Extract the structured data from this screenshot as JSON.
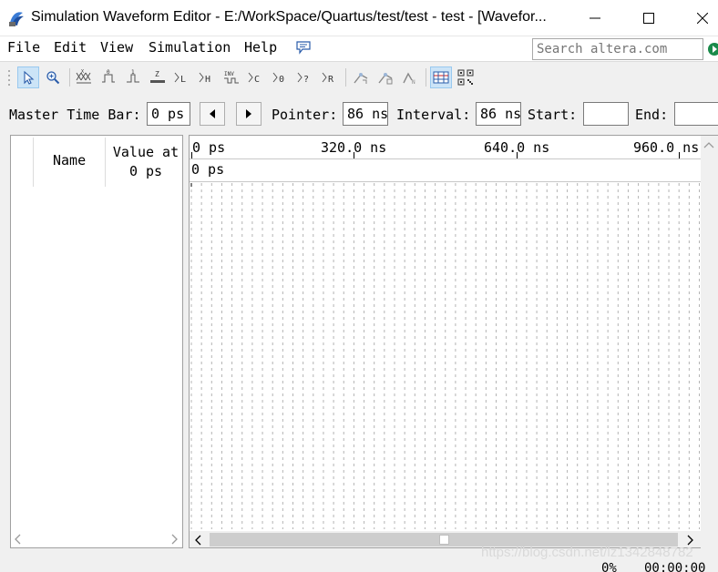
{
  "window": {
    "title": "Simulation Waveform Editor - E:/WorkSpace/Quartus/test/test - test - [Wavefor...",
    "minimize_icon": "minimize-icon",
    "maximize_icon": "maximize-icon",
    "close_icon": "close-icon"
  },
  "menu": {
    "items": [
      "File",
      "Edit",
      "View",
      "Simulation",
      "Help"
    ]
  },
  "search": {
    "placeholder": "Search altera.com"
  },
  "toolbar": {
    "buttons": [
      {
        "name": "selection-tool",
        "label": ""
      },
      {
        "name": "zoom-tool",
        "label": ""
      },
      {
        "name": "forcing-unknown",
        "label": "X"
      },
      {
        "name": "forcing-low",
        "label": "0"
      },
      {
        "name": "forcing-high",
        "label": "1"
      },
      {
        "name": "high-impedance",
        "label": "Z"
      },
      {
        "name": "weak-low",
        "label": "L"
      },
      {
        "name": "weak-high",
        "label": "H"
      },
      {
        "name": "invert",
        "label": "INV"
      },
      {
        "name": "count-value",
        "label": "C"
      },
      {
        "name": "forcing-value",
        "label": "0"
      },
      {
        "name": "random-value",
        "label": "?"
      },
      {
        "name": "arbitrary-value",
        "label": "R"
      }
    ]
  },
  "timebar": {
    "master_label": "Master Time Bar:",
    "master_value": "0 ps",
    "pointer_label": "Pointer:",
    "pointer_value": "86 ns",
    "interval_label": "Interval:",
    "interval_value": "86 ns",
    "start_label": "Start:",
    "start_value": "",
    "end_label": "End:",
    "end_value": ""
  },
  "signal_table": {
    "name_header": "Name",
    "value_header_line1": "Value at",
    "value_header_line2": "0 ps"
  },
  "ruler": {
    "labels": [
      "0 ps",
      "320.0 ns",
      "640.0 ns",
      "960.0 ns"
    ],
    "cursor_label": "0 ps"
  },
  "status": {
    "percent": "0%",
    "elapsed": "00:00:00"
  },
  "watermark": "https://blog.csdn.net/lz1342848782"
}
